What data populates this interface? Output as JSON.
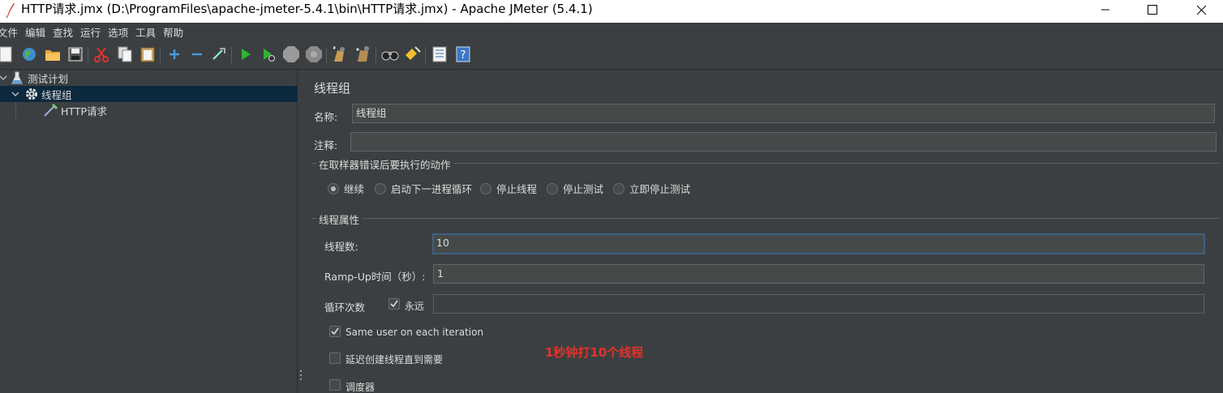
{
  "window": {
    "title": "HTTP请求.jmx (D:\\ProgramFiles\\apache-jmeter-5.4.1\\bin\\HTTP请求.jmx) - Apache JMeter (5.4.1)"
  },
  "menubar": {
    "items": [
      "文件",
      "编辑",
      "查找",
      "运行",
      "选项",
      "工具",
      "帮助"
    ]
  },
  "toolbar": {
    "buttons": [
      "new-icon",
      "templates-icon",
      "open-icon",
      "save-icon",
      "cut-icon",
      "copy-icon",
      "paste-icon",
      "add-icon",
      "remove-icon",
      "toggle-icon",
      "start-icon",
      "start-no-pause-icon",
      "stop-icon",
      "shutdown-icon",
      "clear-icon",
      "clear-all-icon",
      "search-icon",
      "reset-search-icon",
      "function-helper-icon",
      "help-icon"
    ]
  },
  "tree": {
    "items": [
      {
        "label": "测试计划",
        "icon": "flask-icon",
        "expanded": true
      },
      {
        "label": "线程组",
        "icon": "gear-icon",
        "expanded": true,
        "selected": true
      },
      {
        "label": "HTTP请求",
        "icon": "pipette-icon"
      }
    ]
  },
  "thread_group": {
    "title": "线程组",
    "name_label": "名称:",
    "name_value": "线程组",
    "comment_label": "注释:",
    "comment_value": "",
    "error_action": {
      "title": "在取样器错误后要执行的动作",
      "options": [
        "继续",
        "启动下一进程循环",
        "停止线程",
        "停止测试",
        "立即停止测试"
      ],
      "selected": "继续"
    },
    "properties": {
      "title": "线程属性",
      "threads_label": "线程数:",
      "threads_value": "10",
      "rampup_label": "Ramp-Up时间（秒）:",
      "rampup_value": "1",
      "loop_label": "循环次数",
      "loop_forever_label": "永远",
      "loop_forever_checked": true,
      "loop_value": "",
      "same_user_label": "Same user on each iteration",
      "same_user_checked": true,
      "delay_label": "延迟创建线程直到需要",
      "delay_checked": false,
      "scheduler_label": "调度器",
      "scheduler_checked": false
    },
    "annotation": "1秒钟打10个线程"
  },
  "colors": {
    "background": "#3c3f41",
    "selection": "#0d293e",
    "input_bg": "#45494a",
    "focus_border": "#3d6185",
    "annotation": "#e0342a"
  }
}
